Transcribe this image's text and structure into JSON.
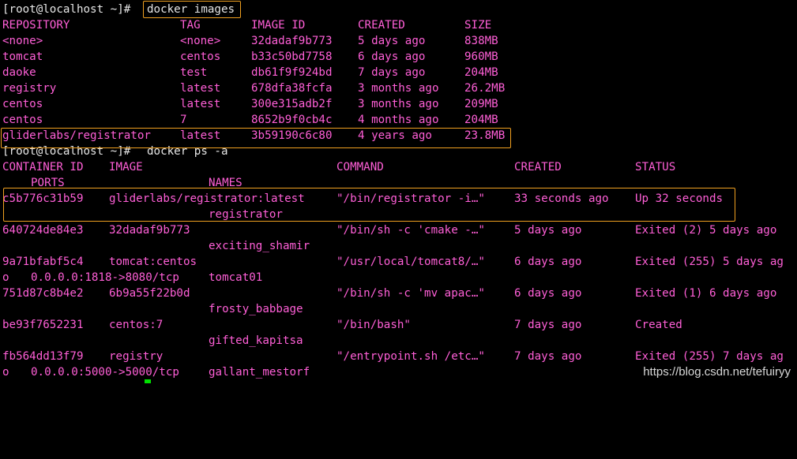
{
  "terminal": {
    "prompt": "[root@localhost ~]#",
    "cmd1": "docker images",
    "cmd2": "docker ps -a",
    "images": {
      "headers": {
        "repo": "REPOSITORY",
        "tag": "TAG",
        "id": "IMAGE ID",
        "created": "CREATED",
        "size": "SIZE"
      },
      "rows": [
        {
          "repo": "<none>",
          "tag": "<none>",
          "id": "32dadaf9b773",
          "created": "5 days ago",
          "size": "838MB"
        },
        {
          "repo": "tomcat",
          "tag": "centos",
          "id": "b33c50bd7758",
          "created": "6 days ago",
          "size": "960MB"
        },
        {
          "repo": "daoke",
          "tag": "test",
          "id": "db61f9f924bd",
          "created": "7 days ago",
          "size": "204MB"
        },
        {
          "repo": "registry",
          "tag": "latest",
          "id": "678dfa38fcfa",
          "created": "3 months ago",
          "size": "26.2MB"
        },
        {
          "repo": "centos",
          "tag": "latest",
          "id": "300e315adb2f",
          "created": "3 months ago",
          "size": "209MB"
        },
        {
          "repo": "centos",
          "tag": "7",
          "id": "8652b9f0cb4c",
          "created": "4 months ago",
          "size": "204MB"
        },
        {
          "repo": "gliderlabs/registrator",
          "tag": "latest",
          "id": "3b59190c6c80",
          "created": "4 years ago",
          "size": "23.8MB"
        }
      ]
    },
    "containers": {
      "headers": {
        "id": "CONTAINER ID",
        "image": "IMAGE",
        "command": "COMMAND",
        "created": "CREATED",
        "status": "STATUS",
        "ports": "PORTS",
        "names": "NAMES"
      },
      "rows": [
        {
          "id": "c5b776c31b59",
          "image": "gliderlabs/registrator:latest",
          "command": "\"/bin/registrator -i…\"",
          "created": "33 seconds ago",
          "status": "Up 32 seconds",
          "ports_prefix": "",
          "ports": "",
          "names": "registrator"
        },
        {
          "id": "640724de84e3",
          "image": "32dadaf9b773",
          "command": "\"/bin/sh -c 'cmake -…\"",
          "created": "5 days ago",
          "status": "Exited (2) 5 days ago",
          "ports_prefix": "",
          "ports": "",
          "names": "exciting_shamir"
        },
        {
          "id": "9a71bfabf5c4",
          "image": "tomcat:centos",
          "command": "\"/usr/local/tomcat8/…\"",
          "created": "6 days ago",
          "status": "Exited (255) 5 days ag",
          "ports_prefix": "o",
          "ports": "0.0.0.0:1818->8080/tcp",
          "names": "tomcat01"
        },
        {
          "id": "751d87c8b4e2",
          "image": "6b9a55f22b0d",
          "command": "\"/bin/sh -c 'mv apac…\"",
          "created": "6 days ago",
          "status": "Exited (1) 6 days ago",
          "ports_prefix": "",
          "ports": "",
          "names": "frosty_babbage"
        },
        {
          "id": "be93f7652231",
          "image": "centos:7",
          "command": "\"/bin/bash\"",
          "created": "7 days ago",
          "status": "Created",
          "ports_prefix": "",
          "ports": "",
          "names": "gifted_kapitsa"
        },
        {
          "id": "fb564dd13f79",
          "image": "registry",
          "command": "\"/entrypoint.sh /etc…\"",
          "created": "7 days ago",
          "status": "Exited (255) 7 days ag",
          "ports_prefix": "o",
          "ports": "0.0.0.0:5000->5000/tcp",
          "names": "gallant_mestorf"
        }
      ]
    }
  },
  "watermark": "https://blog.csdn.net/tefuiryy",
  "colors": {
    "background": "#000000",
    "text": "#ff5fd7",
    "prompt": "#e6e6e6",
    "highlight": "#f0a020",
    "cursor": "#00e000"
  }
}
